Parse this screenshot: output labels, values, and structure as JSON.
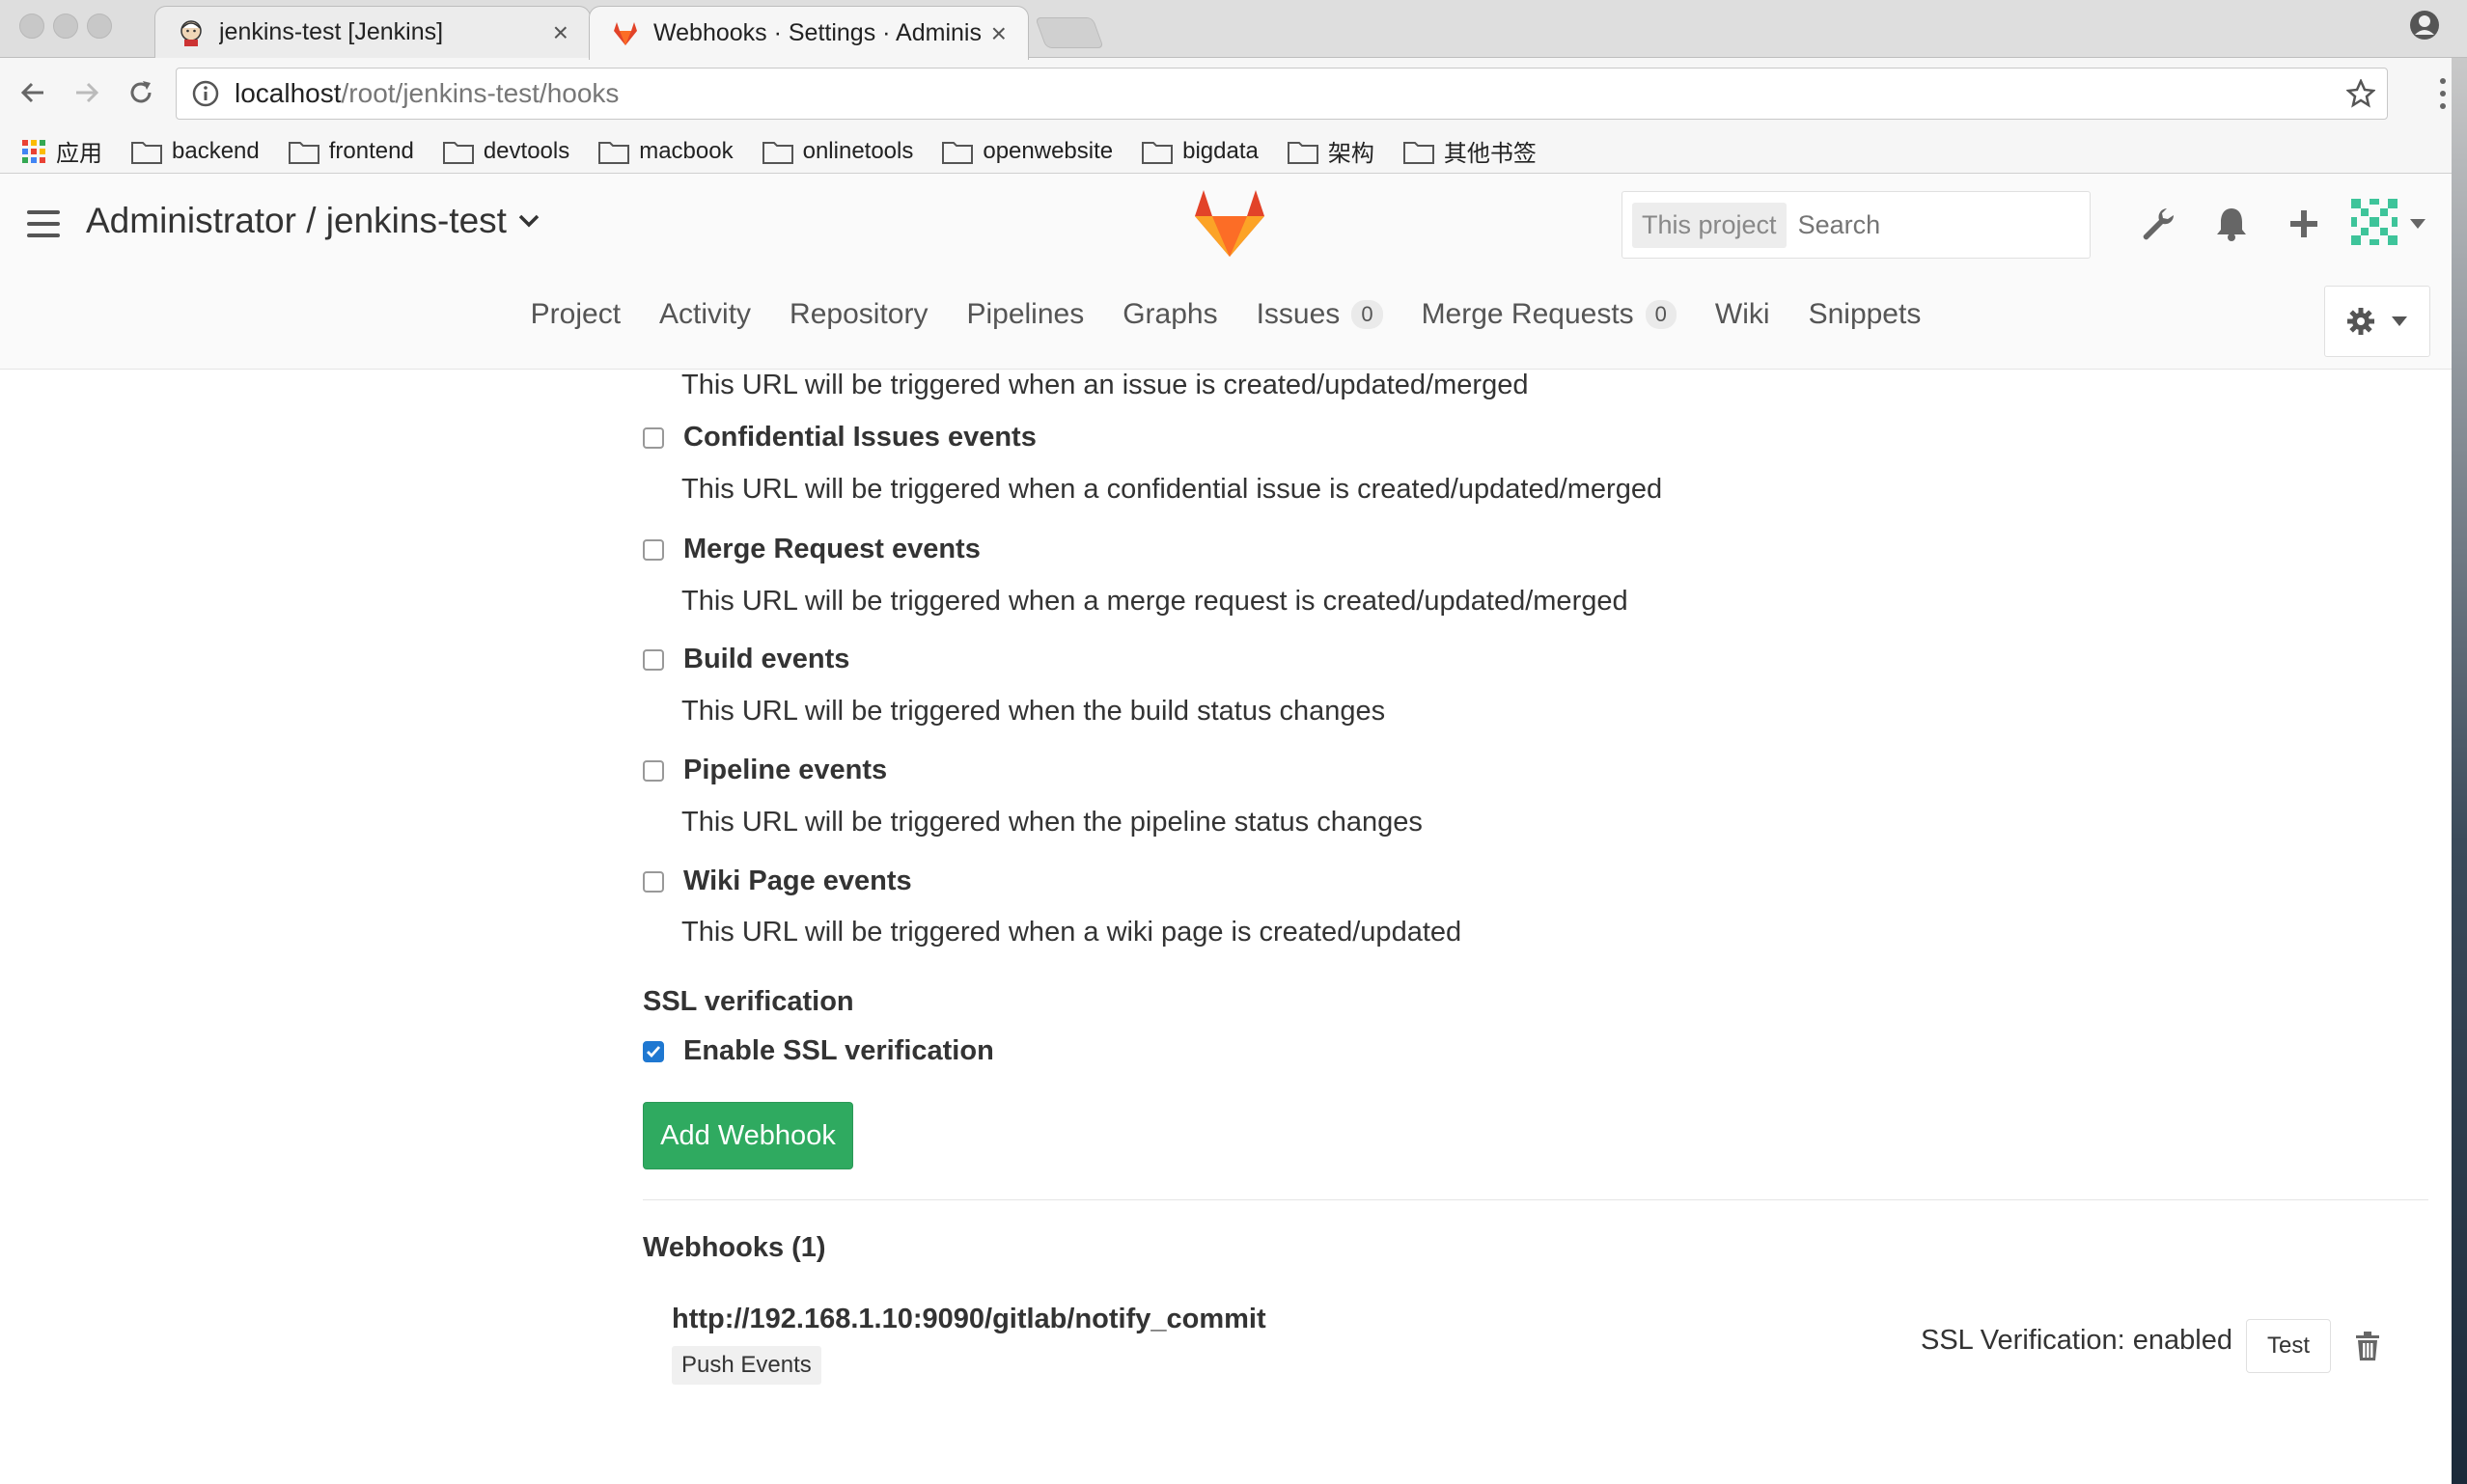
{
  "browser": {
    "tabs": [
      {
        "title": "jenkins-test [Jenkins]",
        "close": "×"
      },
      {
        "title": "Webhooks · Settings · Administrator",
        "close": "×"
      }
    ],
    "address": {
      "host": "localhost",
      "path": "/root/jenkins-test/hooks"
    },
    "bookmarks": [
      {
        "label": "应用",
        "icon": "apps-grid-icon"
      },
      {
        "label": "backend",
        "icon": "folder-icon"
      },
      {
        "label": "frontend",
        "icon": "folder-icon"
      },
      {
        "label": "devtools",
        "icon": "folder-icon"
      },
      {
        "label": "macbook",
        "icon": "folder-icon"
      },
      {
        "label": "onlinetools",
        "icon": "folder-icon"
      },
      {
        "label": "openwebsite",
        "icon": "folder-icon"
      },
      {
        "label": "bigdata",
        "icon": "folder-icon"
      },
      {
        "label": "架构",
        "icon": "folder-icon"
      },
      {
        "label": "其他书签",
        "icon": "folder-icon"
      }
    ]
  },
  "header": {
    "project_path": "Administrator / jenkins-test",
    "search": {
      "scope": "This project",
      "placeholder": "Search"
    },
    "accent": "#e24329"
  },
  "subnav": {
    "items": [
      {
        "label": "Project"
      },
      {
        "label": "Activity"
      },
      {
        "label": "Repository"
      },
      {
        "label": "Pipelines"
      },
      {
        "label": "Graphs"
      },
      {
        "label": "Issues",
        "count": "0"
      },
      {
        "label": "Merge Requests",
        "count": "0"
      },
      {
        "label": "Wiki"
      },
      {
        "label": "Snippets"
      }
    ]
  },
  "form": {
    "partial_description": "This URL will be triggered when an issue is created/updated/merged",
    "events": [
      {
        "label": "Confidential Issues events",
        "description": "This URL will be triggered when a confidential issue is created/updated/merged",
        "checked": false
      },
      {
        "label": "Merge Request events",
        "description": "This URL will be triggered when a merge request is created/updated/merged",
        "checked": false
      },
      {
        "label": "Build events",
        "description": "This URL will be triggered when the build status changes",
        "checked": false
      },
      {
        "label": "Pipeline events",
        "description": "This URL will be triggered when the pipeline status changes",
        "checked": false
      },
      {
        "label": "Wiki Page events",
        "description": "This URL will be triggered when a wiki page is created/updated",
        "checked": false
      }
    ],
    "ssl_title": "SSL verification",
    "ssl_label": "Enable SSL verification",
    "ssl_checked": true,
    "submit_label": "Add Webhook",
    "submit_color": "#2faa60"
  },
  "webhooks": {
    "heading": "Webhooks (1)",
    "list": [
      {
        "url": "http://192.168.1.10:9090/gitlab/notify_commit",
        "tag": "Push Events",
        "ssl": "SSL Verification: enabled",
        "test_label": "Test"
      }
    ]
  }
}
